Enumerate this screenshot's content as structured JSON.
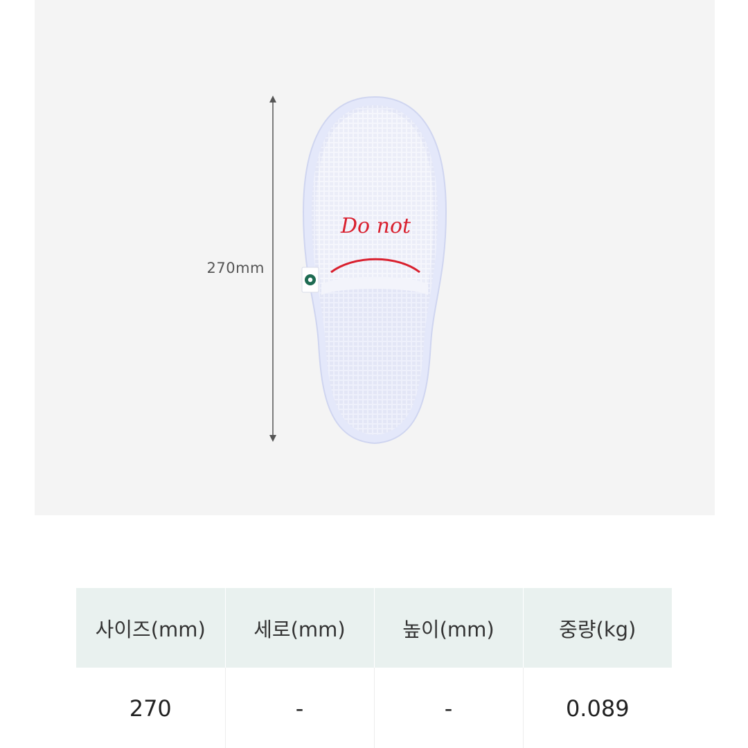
{
  "product_image": {
    "dimension_label": "270mm",
    "embroidery_text": "Do not",
    "colors": {
      "background": "#f4f4f4",
      "slipper": "#f7f8fd",
      "embroidery": "#d9202e",
      "logo_tag": "#1e6b52"
    }
  },
  "spec_table": {
    "headers": [
      "사이즈(mm)",
      "세로(mm)",
      "높이(mm)",
      "중량(kg)"
    ],
    "rows": [
      [
        "270",
        "-",
        "-",
        "0.089"
      ]
    ],
    "header_bg": "#e9f1ef"
  }
}
